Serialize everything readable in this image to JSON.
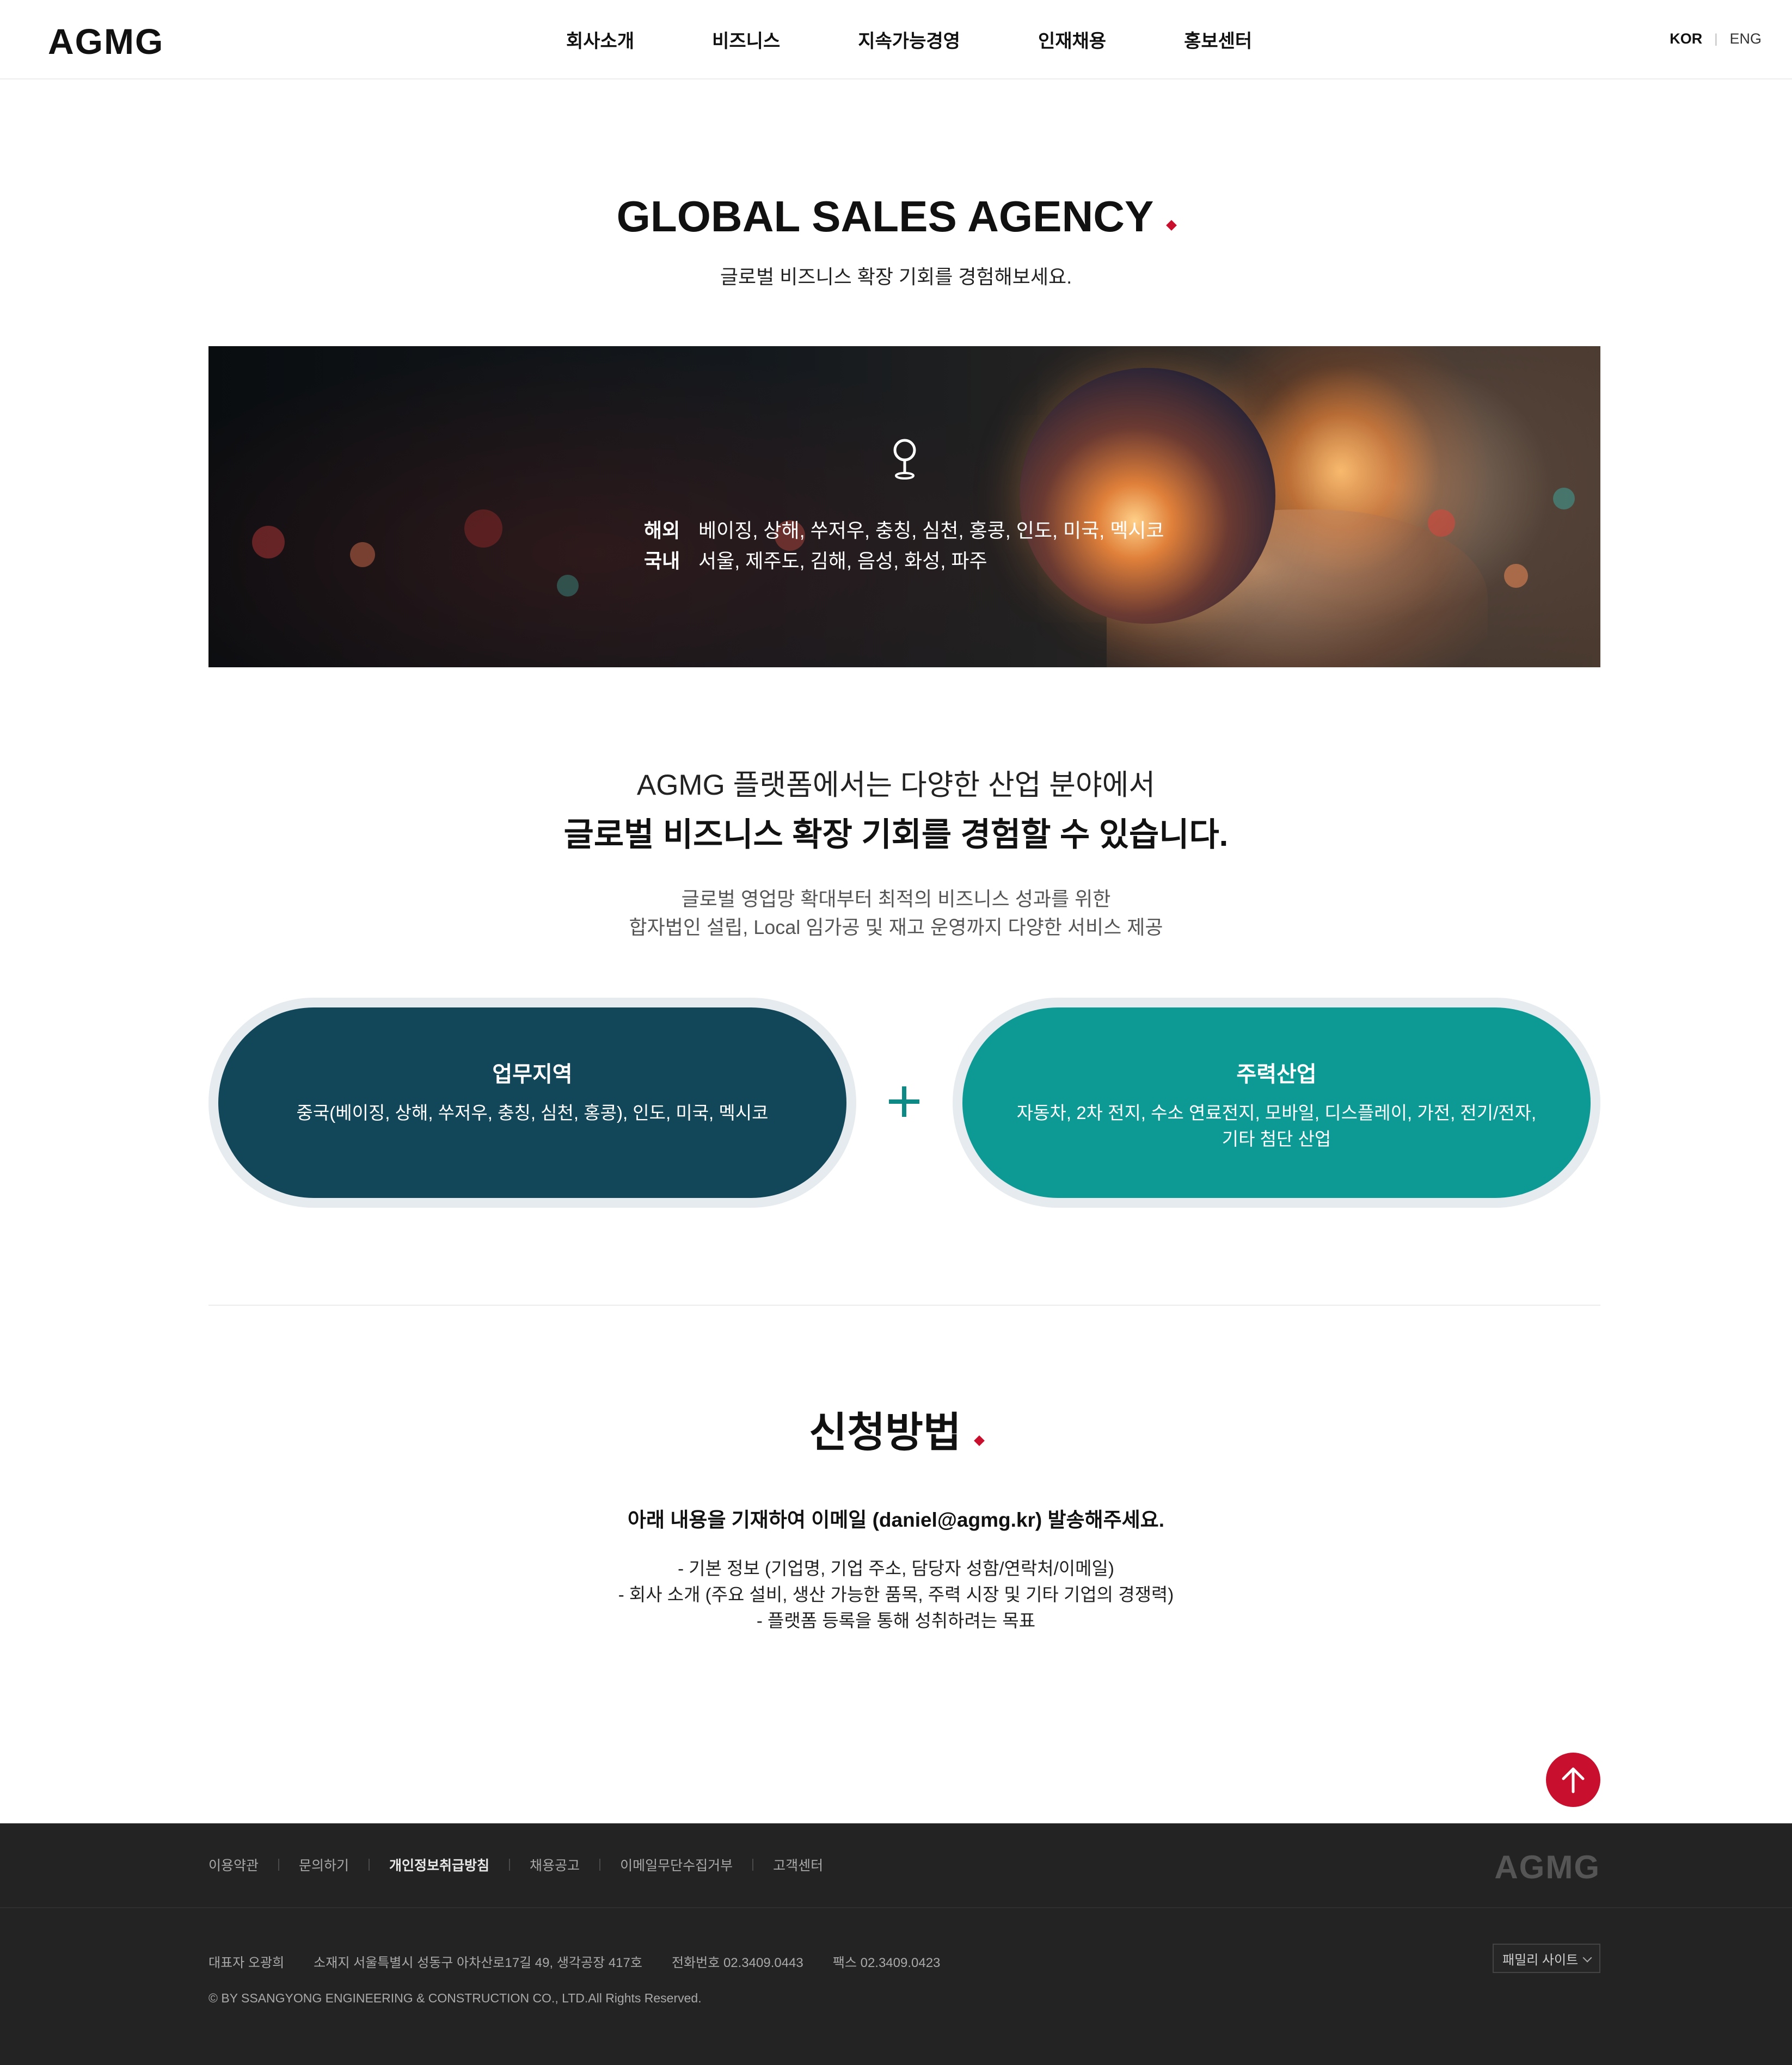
{
  "header": {
    "logo": "AGMG",
    "nav": [
      "회사소개",
      "비즈니스",
      "지속가능경영",
      "인재채용",
      "홍보센터"
    ],
    "lang_kor": "KOR",
    "lang_sep": "|",
    "lang_eng": "ENG"
  },
  "hero": {
    "title": "GLOBAL SALES AGENCY",
    "subtitle": "글로벌 비즈니스 확장 기회를 경험해보세요."
  },
  "banner": {
    "overseas_label": "해외",
    "overseas_value": "베이징, 상해, 쑤저우, 충칭, 심천, 홍콩, 인도, 미국, 멕시코",
    "domestic_label": "국내",
    "domestic_value": "서울, 제주도, 김해, 음성, 화성, 파주"
  },
  "intro": {
    "line1": "AGMG 플랫폼에서는 다양한 산업 분야에서",
    "line2": "글로벌 비즈니스 확장 기회를 경험할 수 있습니다.",
    "desc1": "글로벌 영업망 확대부터 최적의 비즈니스 성과를 위한",
    "desc2": "합자법인 설립, Local 임가공 및 재고 운영까지 다양한 서비스 제공"
  },
  "pills": {
    "left_title": "업무지역",
    "left_text": "중국(베이징, 상해, 쑤저우, 충칭, 심천, 홍콩), 인도, 미국, 멕시코",
    "right_title": "주력산업",
    "right_text1": "자동차, 2차 전지, 수소 연료전지, 모바일, 디스플레이, 가전, 전기/전자,",
    "right_text2": "기타 첨단 산업"
  },
  "apply": {
    "title": "신청방법",
    "lead": "아래 내용을 기재하여 이메일 (daniel@agmg.kr) 발송해주세요.",
    "items": [
      "-  기본 정보 (기업명, 기업 주소, 담당자 성함/연락처/이메일)",
      "-  회사 소개 (주요 설비, 생산 가능한 품목, 주력 시장 및 기타 기업의 경쟁력)",
      "-  플랫폼 등록을 통해 성취하려는 목표"
    ]
  },
  "footer": {
    "links": [
      "이용약관",
      "문의하기",
      "개인정보취급방침",
      "채용공고",
      "이메일무단수집거부",
      "고객센터"
    ],
    "logo": "AGMG",
    "ceo": "대표자 오광희",
    "address": "소재지 서울특별시 성동구 아차산로17길 49, 생각공장 417호",
    "phone": "전화번호 02.3409.0443",
    "fax": "팩스 02.3409.0423",
    "copyright": "© BY SSANGYONG ENGINEERING & CONSTRUCTION CO., LTD.All Rights Reserved.",
    "family_site": "패밀리 사이트"
  },
  "colors": {
    "accent_red": "#c8102e",
    "pill_dark": "#12475a",
    "pill_teal": "#0e9a94",
    "footer_bg": "#232323"
  },
  "icons": {
    "banner_pin": "map-pin-icon",
    "plus": "plus-icon",
    "top_button": "arrow-up-icon",
    "family_chevron": "chevron-down-icon"
  }
}
